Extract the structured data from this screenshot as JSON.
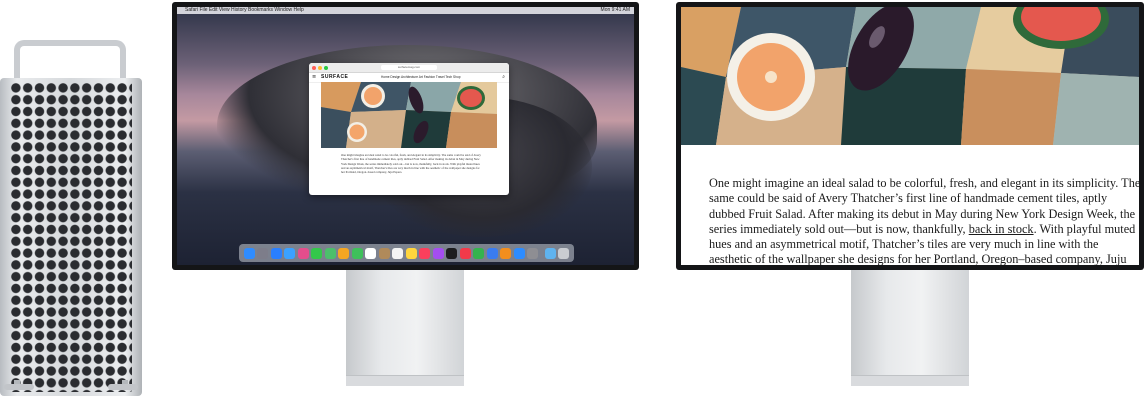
{
  "scene": {
    "devices": [
      "mac-pro-tower",
      "pro-display-desktop",
      "pro-display-zoomed"
    ]
  },
  "menubar": {
    "apple_icon": "",
    "items": "Safari   File   Edit   View   History   Bookmarks   Window   Help",
    "clock": "Mon 9:41 AM"
  },
  "browser": {
    "url": "surfacemag.com",
    "logo": "SURFACE",
    "menu_icon": "≡",
    "links": "Home   Design   Architecture   Art   Fashion   Travel   Tech   Shop",
    "search_icon": "⌕",
    "body_text": "One might imagine an ideal salad to be colorful, fresh, and elegant in its simplicity. The same could be said of Avery Thatcher's first line of handmade cement tiles, aptly dubbed Fruit Salad. After making its debut in May during New York Design Week, the series immediately sold out—but is now, thankfully, back in stock. With playful muted hues and an asymmetrical motif, Thatcher's tiles are very much in line with the aesthetic of the wallpaper she designs for her Portland, Oregon–based company, Juju Papers."
  },
  "dock": {
    "apps": [
      {
        "icon": "finder-icon",
        "color": "#2f8cff"
      },
      {
        "icon": "launchpad-icon",
        "color": "#7d7d8a"
      },
      {
        "icon": "safari-icon",
        "color": "#2a7fff"
      },
      {
        "icon": "mail-icon",
        "color": "#3ba1ff"
      },
      {
        "icon": "photos-icon",
        "color": "#e44d8c"
      },
      {
        "icon": "messages-icon",
        "color": "#33c84a"
      },
      {
        "icon": "maps-icon",
        "color": "#4cbf6b"
      },
      {
        "icon": "photos-icon",
        "color": "#f5a623"
      },
      {
        "icon": "facetime-icon",
        "color": "#3fc05b"
      },
      {
        "icon": "calendar-icon",
        "color": "#ffffff"
      },
      {
        "icon": "contacts-icon",
        "color": "#b08a5a"
      },
      {
        "icon": "reminders-icon",
        "color": "#f4f4f4"
      },
      {
        "icon": "notes-icon",
        "color": "#ffd53d"
      },
      {
        "icon": "music-icon",
        "color": "#fa3f5c"
      },
      {
        "icon": "podcasts-icon",
        "color": "#a44df0"
      },
      {
        "icon": "tv-icon",
        "color": "#1d1d1f"
      },
      {
        "icon": "news-icon",
        "color": "#f23a4a"
      },
      {
        "icon": "numbers-icon",
        "color": "#34b34e"
      },
      {
        "icon": "keynote-icon",
        "color": "#3a7cf0"
      },
      {
        "icon": "pages-icon",
        "color": "#f28e1e"
      },
      {
        "icon": "appstore-icon",
        "color": "#2d8cff"
      },
      {
        "icon": "settings-icon",
        "color": "#8e8e93"
      },
      {
        "icon": "folder-icon",
        "color": "#5fb3ef"
      },
      {
        "icon": "trash-icon",
        "color": "#c9ccd1"
      }
    ]
  },
  "zoom": {
    "text_before_link": "One might imagine an ideal salad to be colorful, fresh, and elegant in its simplicity. The same could be said of Avery Thatcher’s first line of handmade cement tiles, aptly dubbed Fruit Salad. After making its debut in May during New York Design Week, the series immediately sold out—but is now, thankfully, ",
    "link_text": "back in stock",
    "text_after_link": ". With playful muted hues and an asymmetrical motif, Thatcher’s tiles are very much in line with the aesthetic of the wallpaper she designs for her Portland, Oregon–based company, Juju Papers. Suitable for"
  }
}
